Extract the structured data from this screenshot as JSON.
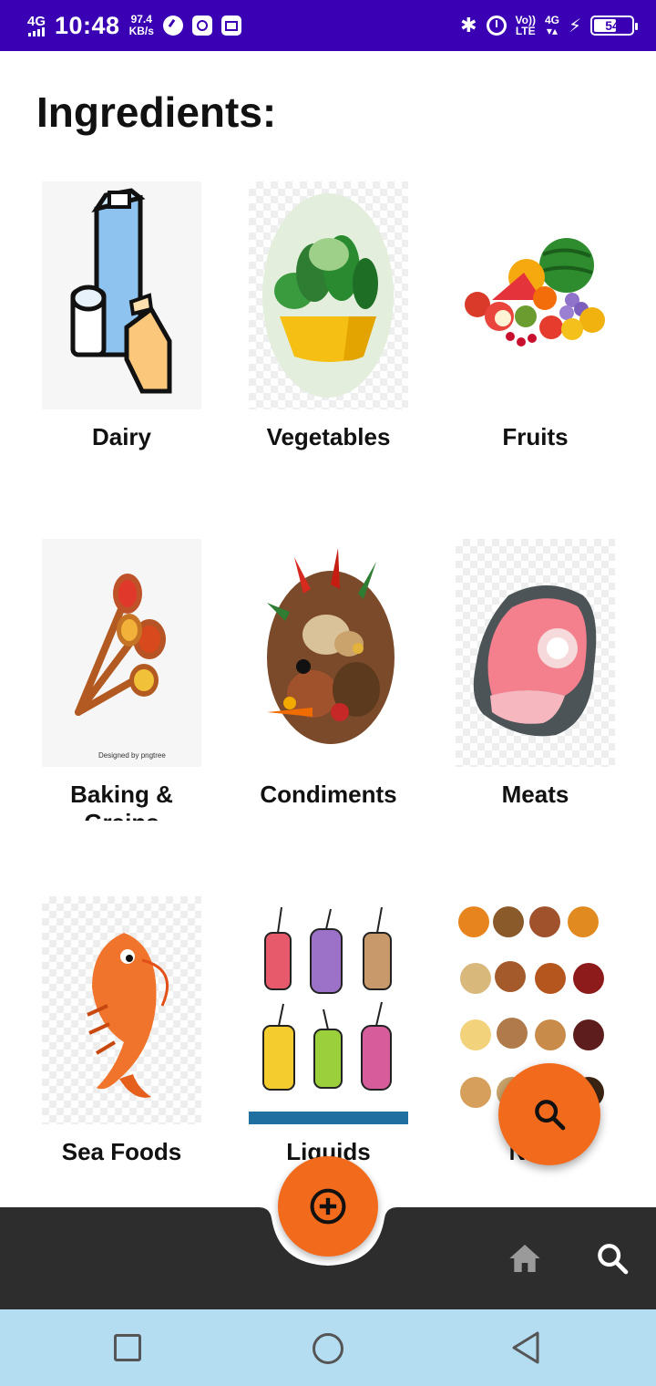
{
  "status_bar": {
    "network": "4G",
    "time": "10:48",
    "speed_value": "97.4",
    "speed_unit": "KB/s",
    "volte_line1": "Vo))",
    "volte_line2": "LTE",
    "network_right": "4G",
    "battery": "54"
  },
  "page": {
    "title": "Ingredients:"
  },
  "categories": [
    {
      "label": "Dairy",
      "icon": "dairy-image"
    },
    {
      "label": "Vegetables",
      "icon": "vegetables-image"
    },
    {
      "label": "Fruits",
      "icon": "fruits-image"
    },
    {
      "label": "Baking & Grains",
      "icon": "baking-grains-image"
    },
    {
      "label": "Condiments",
      "icon": "condiments-image"
    },
    {
      "label": "Meats",
      "icon": "meats-image"
    },
    {
      "label": "Sea Foods",
      "icon": "seafood-image"
    },
    {
      "label": "Liquids",
      "icon": "liquids-image"
    },
    {
      "label": "Nuts",
      "icon": "nuts-image"
    }
  ],
  "fab": {
    "search_icon": "search-icon",
    "add_icon": "plus-circle-icon"
  },
  "bottom_nav": {
    "home_icon": "home-icon",
    "search_icon": "search-icon"
  },
  "colors": {
    "status_bar": "#3a00b3",
    "accent": "#f26a1b",
    "bottom_bar": "#2d2d2d",
    "system_nav": "#b5ddf2"
  }
}
